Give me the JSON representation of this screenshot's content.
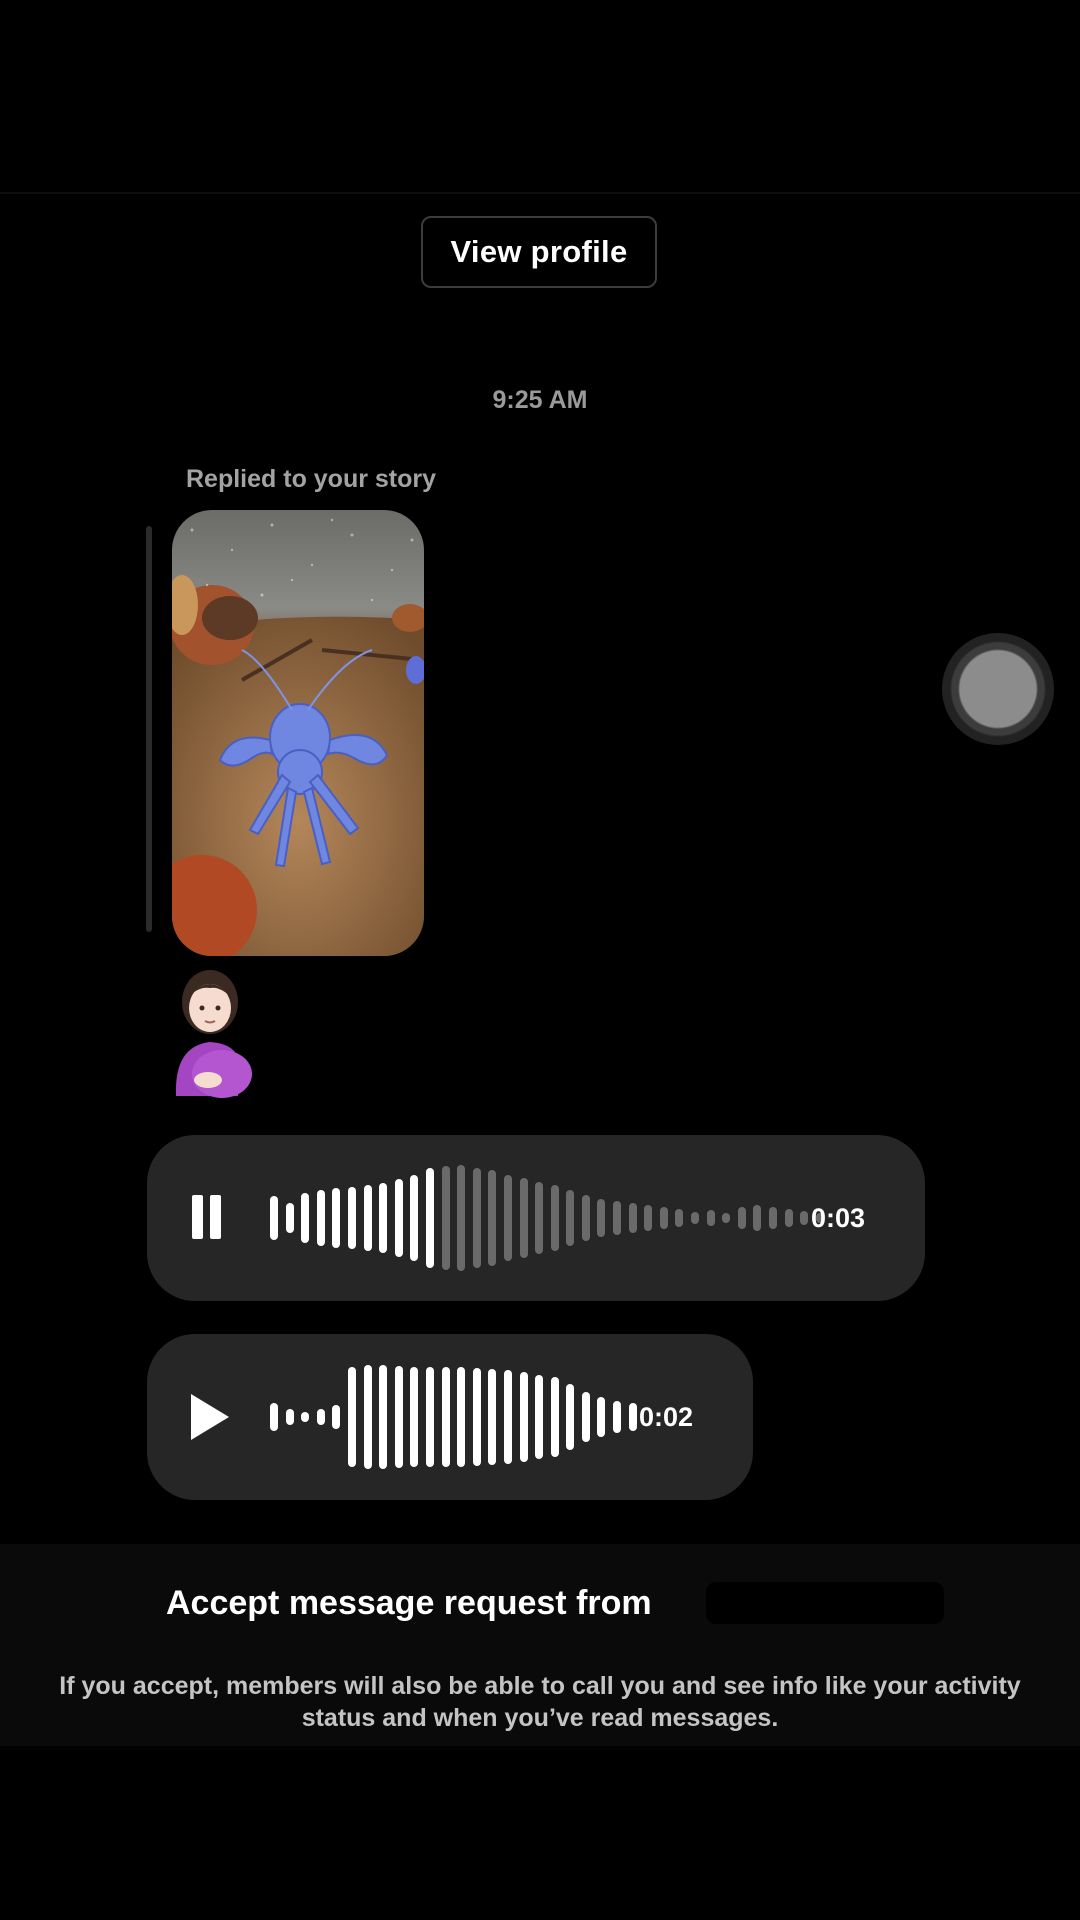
{
  "conversation": {
    "view_profile_label": "View profile",
    "timestamp": "9:25 AM",
    "replied_label": "Replied to your story",
    "reaction_emoji": "pregnant-woman-emoji"
  },
  "voice_messages": [
    {
      "state": "playing",
      "duration": "0:03",
      "icon": "pause-icon",
      "progress": 0.3
    },
    {
      "state": "paused",
      "duration": "0:02",
      "icon": "play-icon",
      "progress": 0
    }
  ],
  "message_request": {
    "title": "Accept message request from",
    "description": "If you accept, members will also be able to call you and see info like your activity status and when you’ve read messages."
  },
  "colors": {
    "background": "#000000",
    "bubble": "#262626",
    "wave_played": "#ffffff",
    "wave_unplayed": "#6a6a6a"
  }
}
